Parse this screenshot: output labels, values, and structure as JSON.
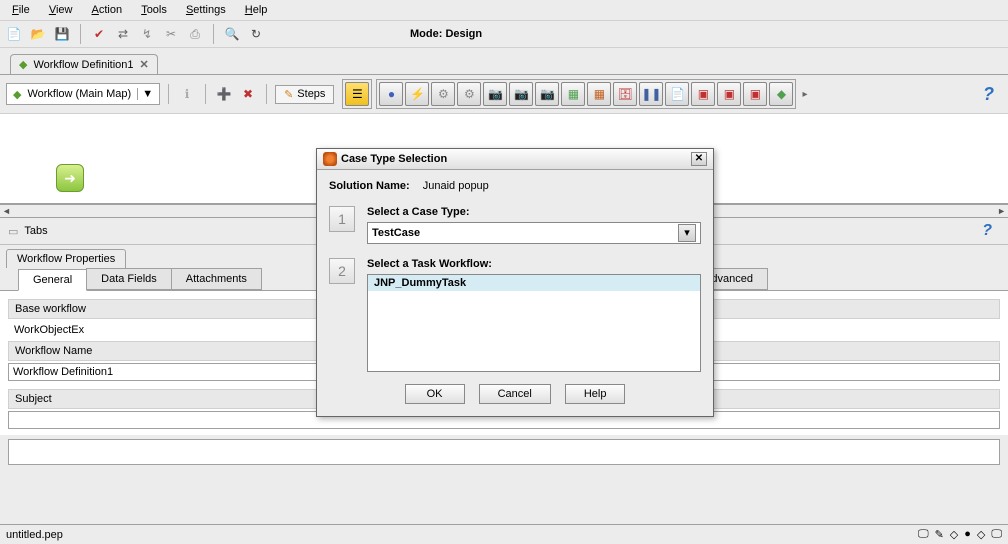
{
  "menu": {
    "file": "File",
    "view": "View",
    "action": "Action",
    "tools": "Tools",
    "settings": "Settings",
    "help": "Help"
  },
  "mode": "Mode: Design",
  "docTab": "Workflow Definition1",
  "workflowCombo": "Workflow (Main Map)",
  "stepsBtn": "Steps",
  "tabsLabel": "Tabs",
  "propsTab": "Workflow Properties",
  "innerTabs": {
    "general": "General",
    "dataFields": "Data Fields",
    "attachments": "Attachments",
    "advanced": "Advanced"
  },
  "form": {
    "baseWorkflowLabel": "Base workflow",
    "workObjectEx": "WorkObjectEx",
    "workflowNameLabel": "Workflow Name",
    "workflowNameValue": "Workflow Definition1",
    "subjectLabel": "Subject",
    "subjectValue": ""
  },
  "status": {
    "file": "untitled.pep"
  },
  "dialog": {
    "title": "Case Type Selection",
    "solutionNameLabel": "Solution Name:",
    "solutionNameValue": "Junaid popup",
    "step1Label": "Select a Case Type:",
    "caseTypeValue": "TestCase",
    "step2Label": "Select a Task Workflow:",
    "taskItem": "JNP_DummyTask",
    "ok": "OK",
    "cancel": "Cancel",
    "help": "Help"
  }
}
